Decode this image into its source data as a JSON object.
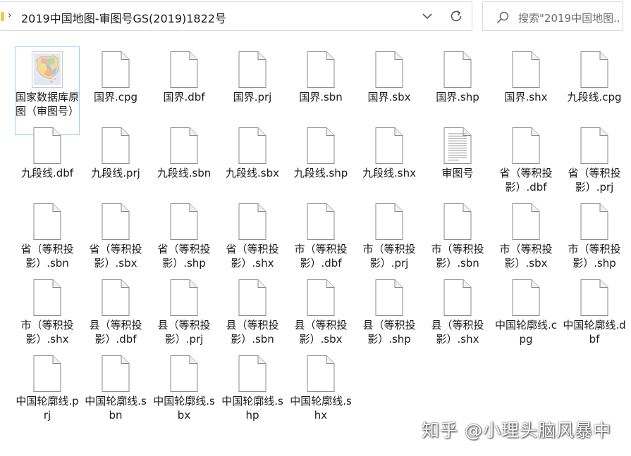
{
  "address_bar": {
    "path": "2019中国地图-审图号GS(2019)1822号"
  },
  "search": {
    "placeholder": "搜索\"2019中国地图..."
  },
  "files": [
    {
      "label": "国家数据库原图（审图号）",
      "icon": "image-thumbnail-icon",
      "selected": true
    },
    {
      "label": "国界.cpg",
      "icon": "blank-file-icon"
    },
    {
      "label": "国界.dbf",
      "icon": "blank-file-icon"
    },
    {
      "label": "国界.prj",
      "icon": "blank-file-icon"
    },
    {
      "label": "国界.sbn",
      "icon": "blank-file-icon"
    },
    {
      "label": "国界.sbx",
      "icon": "blank-file-icon"
    },
    {
      "label": "国界.shp",
      "icon": "blank-file-icon"
    },
    {
      "label": "国界.shx",
      "icon": "blank-file-icon"
    },
    {
      "label": "九段线.cpg",
      "icon": "blank-file-icon"
    },
    {
      "label": "九段线.dbf",
      "icon": "blank-file-icon"
    },
    {
      "label": "九段线.prj",
      "icon": "blank-file-icon"
    },
    {
      "label": "九段线.sbn",
      "icon": "blank-file-icon"
    },
    {
      "label": "九段线.sbx",
      "icon": "blank-file-icon"
    },
    {
      "label": "九段线.shp",
      "icon": "blank-file-icon"
    },
    {
      "label": "九段线.shx",
      "icon": "blank-file-icon"
    },
    {
      "label": "审图号",
      "icon": "text-document-icon"
    },
    {
      "label": "省（等积投影）.dbf",
      "icon": "blank-file-icon"
    },
    {
      "label": "省（等积投影）.prj",
      "icon": "blank-file-icon"
    },
    {
      "label": "省（等积投影）.sbn",
      "icon": "blank-file-icon"
    },
    {
      "label": "省（等积投影）.sbx",
      "icon": "blank-file-icon"
    },
    {
      "label": "省（等积投影）.shp",
      "icon": "blank-file-icon"
    },
    {
      "label": "省（等积投影）.shx",
      "icon": "blank-file-icon"
    },
    {
      "label": "市（等积投影）.dbf",
      "icon": "blank-file-icon"
    },
    {
      "label": "市（等积投影）.prj",
      "icon": "blank-file-icon"
    },
    {
      "label": "市（等积投影）.sbn",
      "icon": "blank-file-icon"
    },
    {
      "label": "市（等积投影）.sbx",
      "icon": "blank-file-icon"
    },
    {
      "label": "市（等积投影）.shp",
      "icon": "blank-file-icon"
    },
    {
      "label": "市（等积投影）.shx",
      "icon": "blank-file-icon"
    },
    {
      "label": "县（等积投影）.dbf",
      "icon": "blank-file-icon"
    },
    {
      "label": "县（等积投影）.prj",
      "icon": "blank-file-icon"
    },
    {
      "label": "县（等积投影）.sbn",
      "icon": "blank-file-icon"
    },
    {
      "label": "县（等积投影）.sbx",
      "icon": "blank-file-icon"
    },
    {
      "label": "县（等积投影）.shp",
      "icon": "blank-file-icon"
    },
    {
      "label": "县（等积投影）.shx",
      "icon": "blank-file-icon"
    },
    {
      "label": "中国轮廓线.cpg",
      "icon": "blank-file-icon"
    },
    {
      "label": "中国轮廓线.dbf",
      "icon": "blank-file-icon"
    },
    {
      "label": "中国轮廓线.prj",
      "icon": "blank-file-icon"
    },
    {
      "label": "中国轮廓线.sbn",
      "icon": "blank-file-icon"
    },
    {
      "label": "中国轮廓线.sbx",
      "icon": "blank-file-icon"
    },
    {
      "label": "中国轮廓线.shp",
      "icon": "blank-file-icon"
    },
    {
      "label": "中国轮廓线.shx",
      "icon": "blank-file-icon"
    }
  ],
  "watermark": {
    "text": "知乎 @小理头脑风暴中"
  },
  "colors": {
    "selection_border": "#99d1ff",
    "folder_accent": "#f2c94c"
  }
}
